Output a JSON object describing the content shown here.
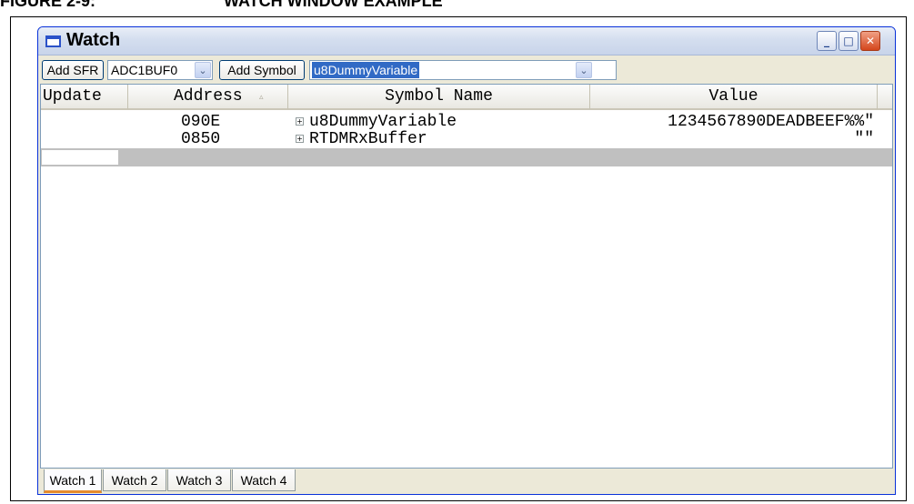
{
  "figure": {
    "number": "FIGURE 2-9:",
    "title": "WATCH WINDOW EXAMPLE"
  },
  "window": {
    "title": "Watch",
    "controls": {
      "minimize": "_",
      "maximize": "□",
      "close": "✕"
    }
  },
  "toolbar": {
    "add_sfr_label": "Add SFR",
    "sfr_select_value": "ADC1BUF0",
    "add_symbol_label": "Add Symbol",
    "symbol_select_value": "u8DummyVariable",
    "dropdown_glyph": "⌄"
  },
  "table": {
    "columns": {
      "update": "Update",
      "address": "Address",
      "symbol_name": "Symbol Name",
      "value": "Value"
    },
    "sort_glyph": "▵",
    "expand_glyph": "+",
    "rows": [
      {
        "update": "",
        "address": "090E",
        "symbol": "u8DummyVariable",
        "value": "1234567890DEADBEEF%%\""
      },
      {
        "update": "",
        "address": "0850",
        "symbol": "RTDMRxBuffer",
        "value": "\"\""
      }
    ]
  },
  "tabs": [
    {
      "label": "Watch 1",
      "active": true
    },
    {
      "label": "Watch 2",
      "active": false
    },
    {
      "label": "Watch 3",
      "active": false
    },
    {
      "label": "Watch 4",
      "active": false
    }
  ],
  "colors": {
    "accent": "#0831d9",
    "selection": "#316ac5",
    "active_tab": "#e68b2c",
    "close_button": "#d4461c"
  }
}
